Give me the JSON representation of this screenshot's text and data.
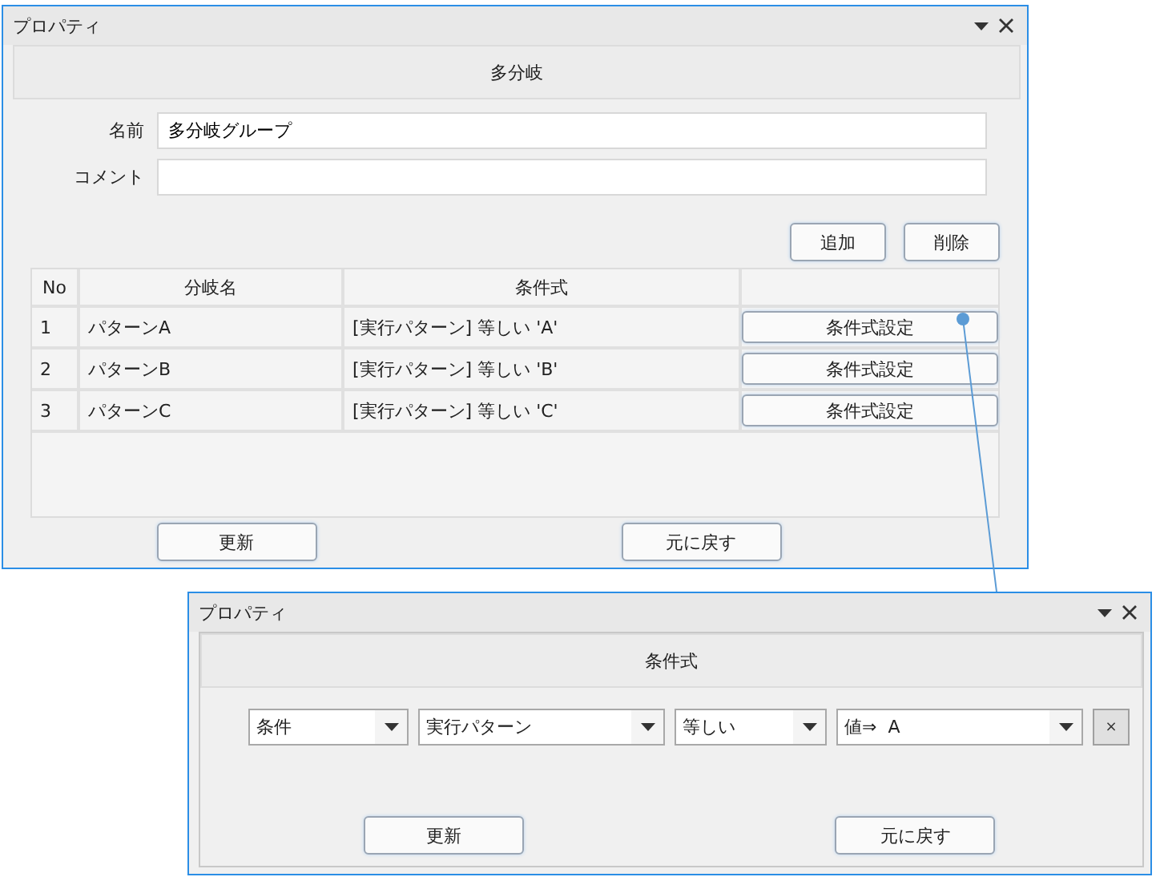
{
  "windows": [
    {
      "title": "プロパティ",
      "header": "多分岐",
      "fields": [
        {
          "label": "名前",
          "value": "多分岐グループ"
        },
        {
          "label": "コメント"
        }
      ],
      "actions": [
        "追加",
        "削除"
      ],
      "table": {
        "columns": [
          "No",
          "分岐名",
          "条件式"
        ],
        "rows": [
          {
            "no": "1",
            "name": "パターンA",
            "condition": "[実行パターン] 等しい 'A'",
            "button": "条件式設定"
          },
          {
            "no": "2",
            "name": "パターンB",
            "condition": "[実行パターン] 等しい 'B'",
            "button": "条件式設定"
          },
          {
            "no": "3",
            "name": "パターンC",
            "condition": "[実行パターン] 等しい 'C'",
            "button": "条件式設定"
          }
        ]
      },
      "buttons": [
        "更新",
        "元に戻す"
      ]
    },
    {
      "title": "プロパティ",
      "header": "条件式",
      "dropdowns": [
        {
          "value": "条件"
        },
        {
          "value": "実行パターン"
        },
        {
          "value": "等しい"
        },
        {
          "value": "値⇒  A"
        }
      ],
      "remove_button": "×",
      "buttons": [
        "更新",
        "元に戻す"
      ]
    }
  ]
}
